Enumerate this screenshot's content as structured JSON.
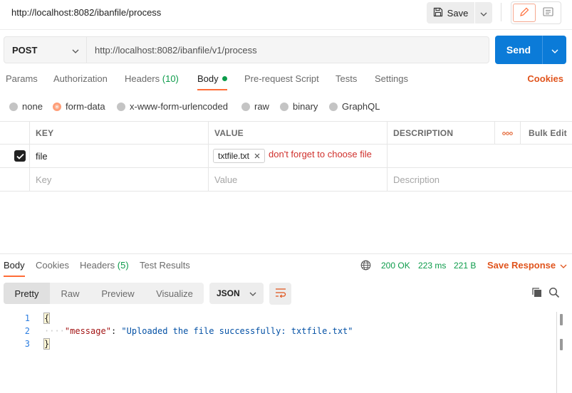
{
  "titlebar": {
    "url": "http://localhost:8082/ibanfile/process",
    "save_label": "Save",
    "icons": [
      "save-icon",
      "chevron-down-icon",
      "pencil-icon",
      "document-icon"
    ]
  },
  "request": {
    "method": "POST",
    "url": "http://localhost:8082/ibanfile/v1/process",
    "send_label": "Send"
  },
  "request_tabs": {
    "params": "Params",
    "authorization": "Authorization",
    "headers_label": "Headers",
    "headers_count": "(10)",
    "body": "Body",
    "prerequest": "Pre-request Script",
    "tests": "Tests",
    "settings": "Settings",
    "cookies": "Cookies",
    "active": "Body"
  },
  "body_types": {
    "none": "none",
    "form_data": "form-data",
    "urlencoded": "x-www-form-urlencoded",
    "raw": "raw",
    "binary": "binary",
    "graphql": "GraphQL",
    "selected": "form-data"
  },
  "params_table": {
    "headers": {
      "key": "KEY",
      "value": "VALUE",
      "description": "DESCRIPTION",
      "more": "ooo",
      "bulk_edit": "Bulk Edit"
    },
    "rows": [
      {
        "checked": true,
        "key": "file",
        "value_file": "txtfile.txt",
        "annotation": "don't forget to choose file",
        "description": ""
      }
    ],
    "placeholders": {
      "key": "Key",
      "value": "Value",
      "description": "Description"
    }
  },
  "response": {
    "tabs": {
      "body": "Body",
      "cookies": "Cookies",
      "headers_label": "Headers",
      "headers_count": "(5)",
      "test_results": "Test Results",
      "active": "Body"
    },
    "status": "200 OK",
    "time": "223 ms",
    "size": "221 B",
    "save_response": "Save Response",
    "views": {
      "pretty": "Pretty",
      "raw": "Raw",
      "preview": "Preview",
      "visualize": "Visualize",
      "active": "Pretty"
    },
    "format": "JSON",
    "code_lines": [
      {
        "num": "1",
        "text": "{"
      },
      {
        "num": "2",
        "key": "\"message\"",
        "sep": ": ",
        "value": "\"Uploaded the file successfully: txtfile.txt\""
      },
      {
        "num": "3",
        "text": "}"
      }
    ]
  },
  "colors": {
    "accent_orange": "#ff6c37",
    "send_blue": "#0b7bd8",
    "status_green": "#0c9b4a",
    "annotation_red": "#d0312d"
  }
}
